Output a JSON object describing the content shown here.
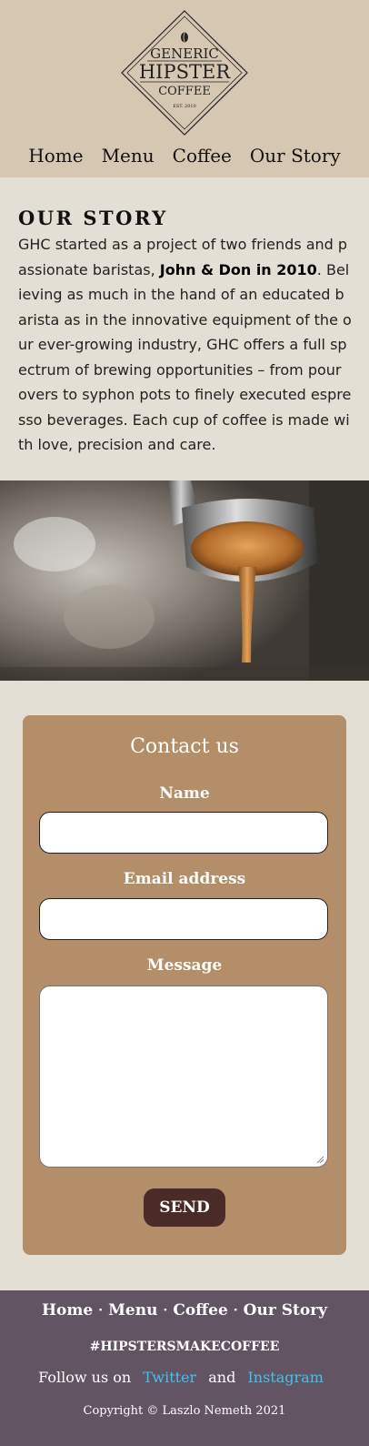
{
  "header": {
    "logo": {
      "line1": "GENERIC",
      "line2": "HIPSTER",
      "line3": "COFFEE",
      "est": "EST. 2010",
      "icon": "coffee-bean-icon"
    },
    "nav": [
      "Home",
      "Menu",
      "Coffee",
      "Our Story"
    ]
  },
  "story": {
    "title": "OUR STORY",
    "text_before": "GHC started as a project of two friends and passionate baristas, ",
    "text_bold": "John & Don in 2010",
    "text_after": ". Believing as much in the hand of an educated barista as in the innovative equipment of the our ever-growing industry, GHC offers a full spectrum of brewing opportunities – from pour overs to syphon pots to finely executed espresso beverages. Each cup of coffee is made with love, precision and care."
  },
  "contact": {
    "title": "Contact us",
    "name_label": "Name",
    "email_label": "Email address",
    "message_label": "Message",
    "send_label": "SEND"
  },
  "footer": {
    "nav": [
      "Home",
      "Menu",
      "Coffee",
      "Our Story"
    ],
    "separator": "·",
    "hashtag": "#HIPSTERSMAKECOFFEE",
    "follow_prefix": "Follow us on",
    "twitter": "Twitter",
    "and": "and",
    "instagram": "Instagram",
    "copyright": "Copyright © Laszlo Nemeth 2021"
  },
  "colors": {
    "header_bg": "#d6c7b3",
    "body_bg": "#e4dfd5",
    "contact_bg": "#b48e69",
    "button_bg": "#4a2b27",
    "footer_bg": "#625462",
    "link": "#3ec3f0"
  }
}
